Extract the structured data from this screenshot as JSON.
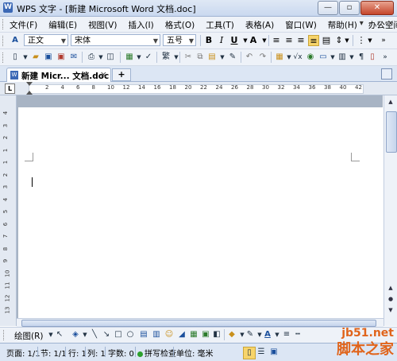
{
  "window": {
    "app_icon": "W",
    "title": "WPS 文字 - [新建 Microsoft Word 文档.doc]",
    "minimize": "—",
    "maximize": "▫",
    "close": "✕"
  },
  "menu": {
    "items": [
      "文件(F)",
      "编辑(E)",
      "视图(V)",
      "插入(I)",
      "格式(O)",
      "工具(T)",
      "表格(A)",
      "窗口(W)",
      "帮助(H)",
      "办公空间(K)"
    ],
    "mdi_controls": [
      "▾",
      "–",
      "▫",
      "×"
    ]
  },
  "formatting": {
    "style": "正文",
    "font": "宋体",
    "size": "五号",
    "bold": "B",
    "italic": "I",
    "underline": "U",
    "font_color": "A"
  },
  "tabs": {
    "active_label": "新建 Micr... 文档.doc",
    "tab_close": "×",
    "new_tab": "+"
  },
  "ruler": {
    "numbers": [
      "2",
      "4",
      "6",
      "8",
      "10",
      "12",
      "14",
      "16",
      "18",
      "20",
      "22",
      "24",
      "26",
      "28",
      "30",
      "32",
      "34",
      "36",
      "38",
      "40",
      "42"
    ],
    "corner": "L"
  },
  "vruler": {
    "numbers": [
      "4",
      "3",
      "2",
      "1",
      "1",
      "2",
      "3",
      "4",
      "5",
      "6",
      "7",
      "8",
      "9",
      "10",
      "11",
      "12",
      "13"
    ]
  },
  "drawing": {
    "label": "绘图(R)"
  },
  "status": {
    "page": "页面: 1/1",
    "section": "节: 1/1",
    "line": "行: 1",
    "column": "列: 1",
    "words": "字数: 0",
    "spell": "拼写检查",
    "unit": "单位: 毫米"
  },
  "watermark": {
    "line1": "jb51.net",
    "line2": "脚本之家"
  }
}
